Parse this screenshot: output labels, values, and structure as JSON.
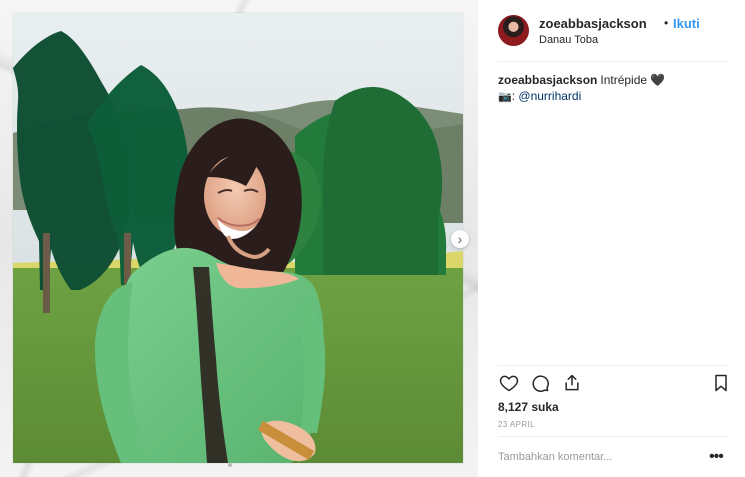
{
  "post": {
    "username": "zoeabbasjackson",
    "dot": "•",
    "follow_label": "Ikuti",
    "location": "Danau Toba",
    "caption": {
      "user": "zoeabbasjackson",
      "text": "Intrépide",
      "heart": "🖤",
      "camera": "📷",
      "colon": ":",
      "tag": "@nurrihardi"
    },
    "likes": "8,127 suka",
    "date": "23 APRIL",
    "comment_placeholder": "Tambahkan komentar...",
    "more_label": "•••"
  },
  "icons": {
    "carousel_next": "chevron-right-icon",
    "like": "heart-icon",
    "comment": "comment-icon",
    "share": "share-icon",
    "save": "bookmark-icon"
  },
  "colors": {
    "accent": "#3897f0",
    "link": "#003569",
    "text": "#262626",
    "muted": "#999999",
    "divider": "#efefef"
  }
}
